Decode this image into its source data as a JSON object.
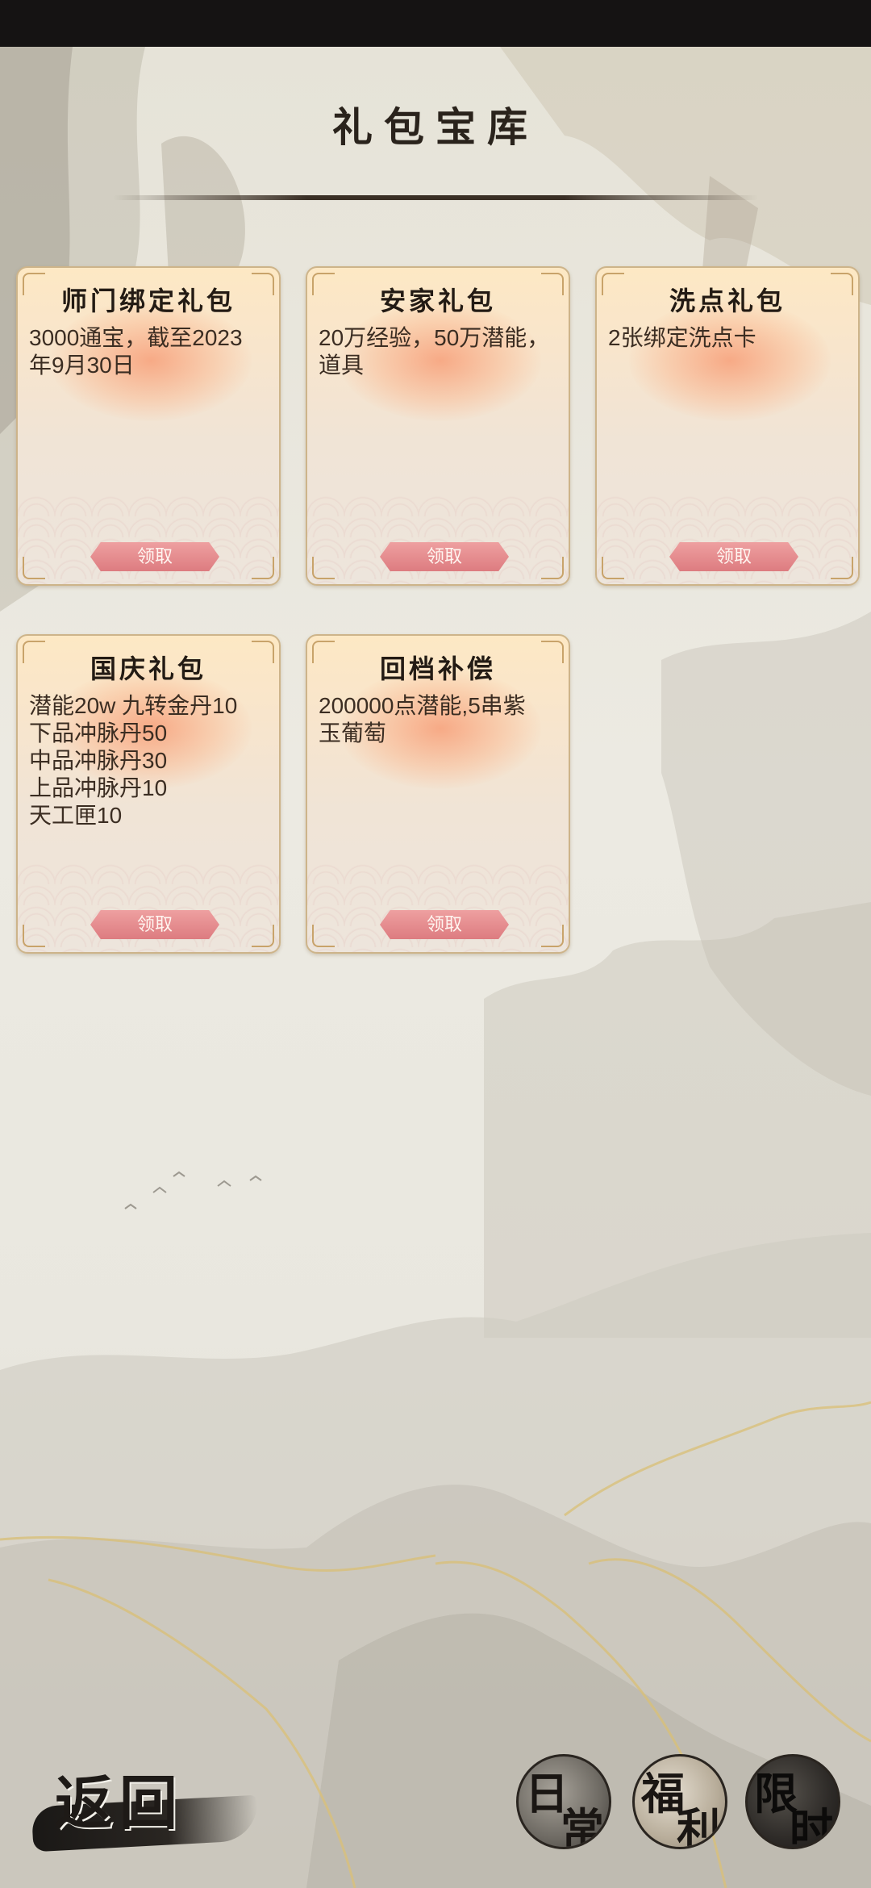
{
  "header": {
    "title": "礼包宝库"
  },
  "cards": [
    {
      "title": "师门绑定礼包",
      "desc": "3000通宝，截至2023\n年9月30日",
      "button": "领取"
    },
    {
      "title": "安家礼包",
      "desc": "20万经验，50万潜能，\n道具",
      "button": "领取"
    },
    {
      "title": "洗点礼包",
      "desc": "2张绑定洗点卡",
      "button": "领取"
    },
    {
      "title": "国庆礼包",
      "desc": "潜能20w 九转金丹10\n下品冲脉丹50\n中品冲脉丹30\n上品冲脉丹10\n天工匣10",
      "button": "领取"
    },
    {
      "title": "回档补偿",
      "desc": "200000点潜能,5串紫\n玉葡萄",
      "button": "领取"
    }
  ],
  "footer": {
    "back_label": "返回",
    "seals": [
      {
        "top": "日",
        "bottom": "常"
      },
      {
        "top": "福",
        "bottom": "利"
      },
      {
        "top": "限",
        "bottom": "时"
      }
    ]
  }
}
